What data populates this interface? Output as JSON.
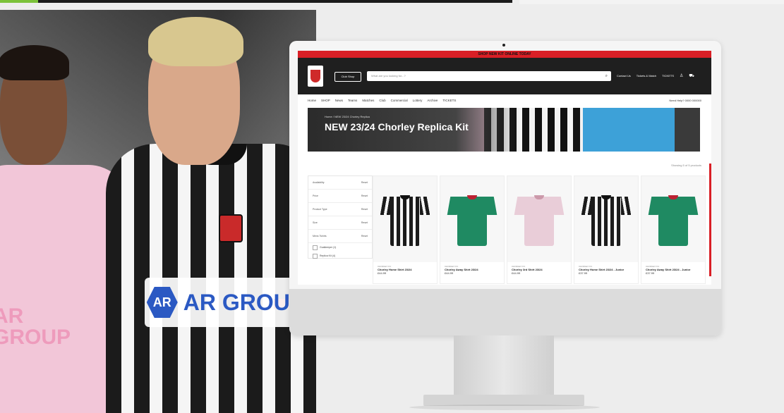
{
  "site": {
    "announcement": "SHOP NEW KIT ONLINE TODAY",
    "shop_button": "Club Shop",
    "search_placeholder": "What are you looking for...?",
    "header_links": [
      "Contact Us",
      "Tickets & Match",
      "TICKETS"
    ],
    "menu": [
      "Home",
      "SHOP",
      "News",
      "Teams",
      "Matches",
      "Club",
      "Commercial",
      "Lottery",
      "Archive",
      "TICKETS"
    ],
    "phone": "Need Help? 0000 000000",
    "banner": {
      "breadcrumb": "Home / NEW 23/24 Chorley Replica",
      "title": "NEW 23/24 Chorley Replica Kit"
    },
    "results_text": "Showing 5 of 5 products",
    "filters": [
      {
        "label": "Availability",
        "action": "Reset"
      },
      {
        "label": "Price",
        "action": "Reset"
      },
      {
        "label": "Product Type",
        "action": "Reset"
      },
      {
        "label": "Size",
        "action": "Reset"
      },
      {
        "label": "Mens Tshirts",
        "action": "Reset"
      }
    ],
    "filter_checks": [
      "Goalkeeper (1)",
      "Replica Kit (4)"
    ],
    "products": [
      {
        "brand": "CHORLEY FC",
        "name": "Chorley Home Shirt 23/24",
        "price": "£44.99",
        "style": "stripe"
      },
      {
        "brand": "CHORLEY FC",
        "name": "Chorley Away Shirt 23/24",
        "price": "£44.99",
        "style": "green"
      },
      {
        "brand": "CHORLEY FC",
        "name": "Chorley 3rd Shirt 23/24",
        "price": "£44.99",
        "style": "pink"
      },
      {
        "brand": "CHORLEY FC",
        "name": "Chorley Home Shirt 23/24 - Junior",
        "price": "£37.99",
        "style": "stripe"
      },
      {
        "brand": "CHORLEY FC",
        "name": "Chorley Away Shirt 23/24 - Junior",
        "price": "£37.99",
        "style": "green"
      }
    ]
  },
  "hero": {
    "left_sponsor": "AR GROUP",
    "right_sponsor_hex": "AR",
    "right_sponsor": "AR GROUP"
  },
  "colors": {
    "brand_red": "#d91f26",
    "dark": "#1f1f1f",
    "green_kit": "#1f8a62",
    "pink_kit": "#e9cdd8"
  }
}
